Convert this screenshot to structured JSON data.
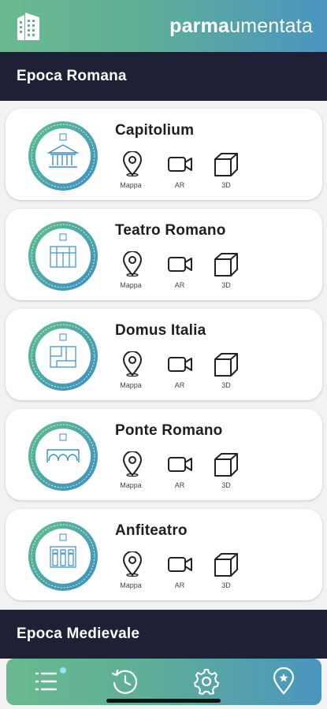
{
  "header": {
    "brand_bold": "parma",
    "brand_regular": "umentata",
    "logo_icon": "building-icon"
  },
  "sections": [
    {
      "title": "Epoca Romana"
    },
    {
      "title": "Epoca Medievale"
    }
  ],
  "cards": [
    {
      "title": "Capitolium",
      "medal_icon": "temple-icon"
    },
    {
      "title": "Teatro Romano",
      "medal_icon": "theatre-icon"
    },
    {
      "title": "Domus Italia",
      "medal_icon": "floorplan-icon"
    },
    {
      "title": "Ponte Romano",
      "medal_icon": "bridge-icon"
    },
    {
      "title": "Anfiteatro",
      "medal_icon": "amphitheatre-icon"
    }
  ],
  "actions": {
    "map_label": "Mappa",
    "ar_label": "AR",
    "td_label": "3D"
  },
  "tabbar": {
    "items": [
      "list-icon",
      "history-icon",
      "settings-icon",
      "map-pin-icon"
    ]
  },
  "colors": {
    "gradient_start": "#69b98f",
    "gradient_end": "#4a95c0",
    "section_bar": "#1f1f36"
  }
}
